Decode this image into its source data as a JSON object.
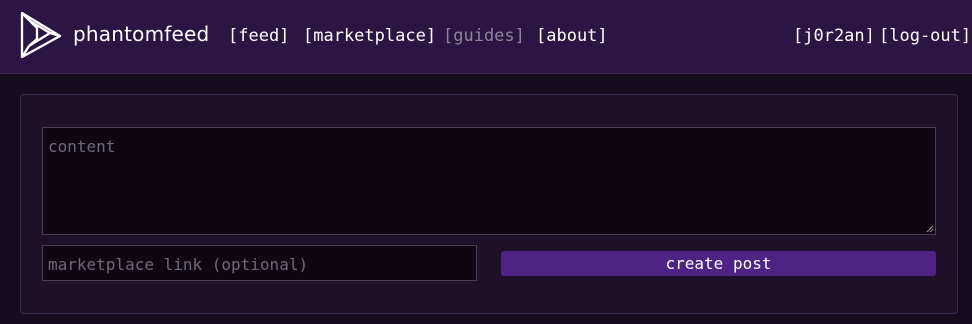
{
  "header": {
    "logo_icon": "impossible-triangle-logo-icon",
    "brand": "phantomfeed",
    "nav": [
      {
        "label": "[feed]",
        "state": "normal"
      },
      {
        "label": "[marketplace]",
        "state": "normal"
      },
      {
        "label": "[guides]",
        "state": "muted"
      },
      {
        "label": "[about]",
        "state": "normal"
      }
    ],
    "user": "[j0r2an]",
    "logout": "[log-out]"
  },
  "form": {
    "content_placeholder": "content",
    "link_placeholder": "marketplace link (optional)",
    "submit_label": "create post"
  },
  "colors": {
    "header_bg": "#2b1543",
    "page_bg": "#150c1d",
    "panel_bg": "#1f1128",
    "button_bg": "#4f2286",
    "muted_link": "#8f8599"
  }
}
